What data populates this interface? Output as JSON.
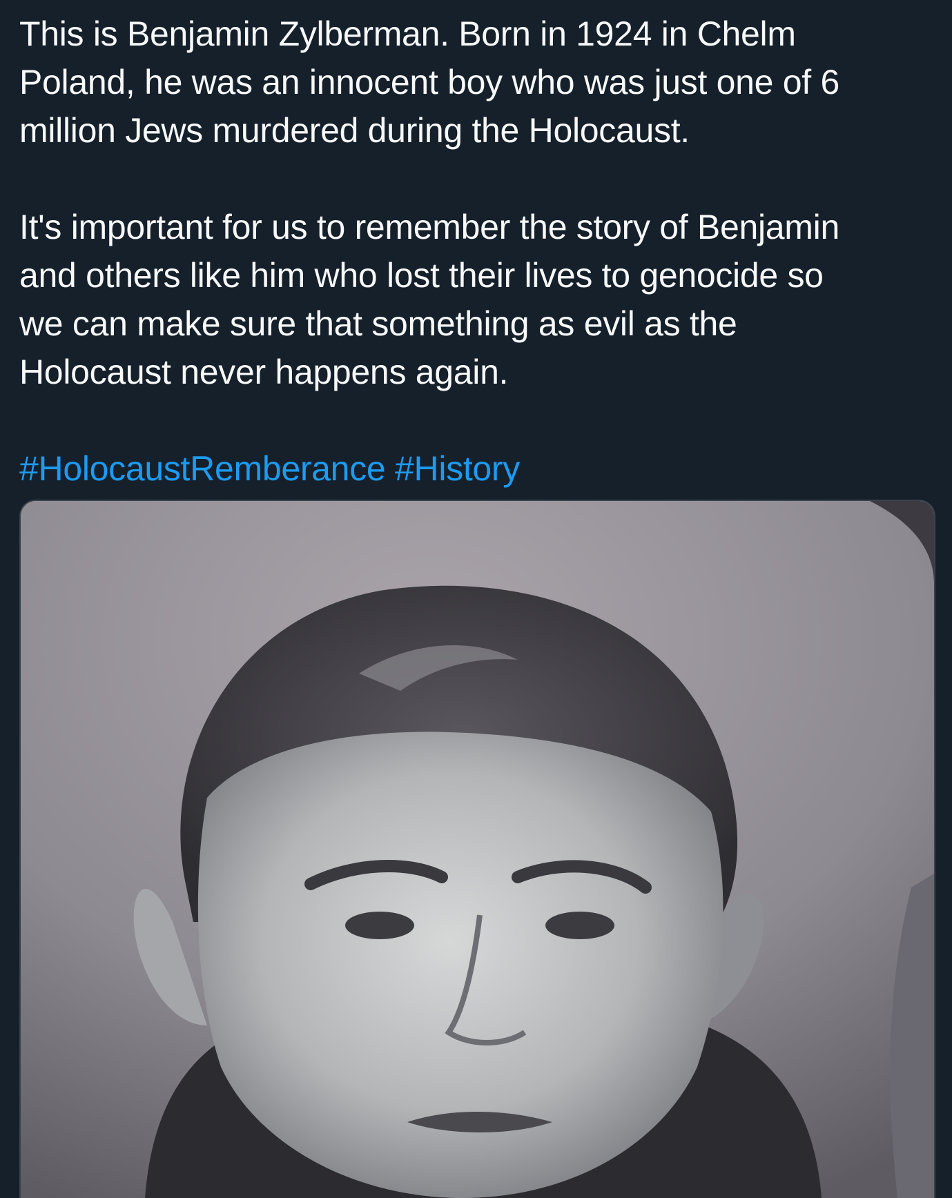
{
  "tweet": {
    "paragraph1": [
      "This is Benjamin Zylberman. Born in 1924 in Chelm",
      "Poland, he was an innocent boy who was just one of 6",
      "million Jews murdered during the Holocaust."
    ],
    "paragraph2": [
      "It's important for us to remember the story of Benjamin",
      "and others like him who lost their lives to genocide so",
      "we can make sure that something as evil as the",
      "Holocaust never happens again."
    ],
    "hashtags": [
      "#HolocaustRemberance",
      "#History"
    ]
  },
  "colors": {
    "background": "#15202b",
    "text": "#f7f9f9",
    "hashtag": "#1d9bf0",
    "media_border": "#38444d"
  },
  "media": {
    "icon": "photo-icon"
  }
}
